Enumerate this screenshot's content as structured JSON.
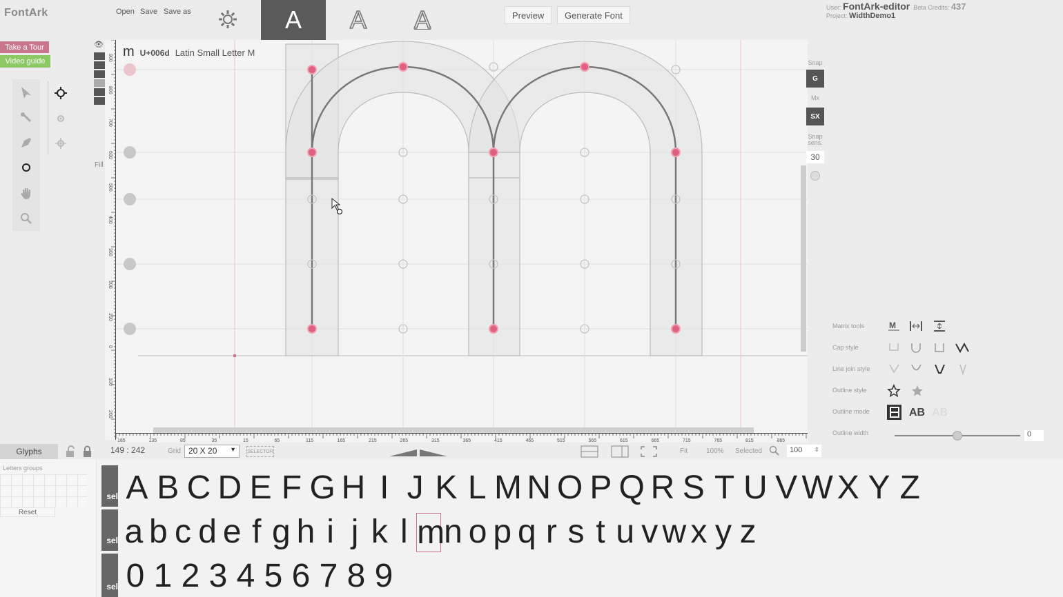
{
  "app": {
    "logo": "FontArk"
  },
  "menu": {
    "open": "Open",
    "save": "Save",
    "save_as": "Save as"
  },
  "toolbar": {
    "style_buttons": [
      {
        "label": "A",
        "state": "active"
      },
      {
        "label": "A",
        "state": "outline"
      },
      {
        "label": "A",
        "state": "outline-underline"
      }
    ],
    "preview": "Preview",
    "generate": "Generate Font"
  },
  "user": {
    "user_label": "User:",
    "username": "FontArk-editor",
    "credits_label": "Beta Credits:",
    "credits": "437",
    "project_label": "Project:",
    "project": "WidthDemo1"
  },
  "left_panel": {
    "tour": "Take a Tour",
    "video": "Video guide",
    "tools": [
      "select-arrow-icon",
      "node-select-icon",
      "pen-icon",
      "circle-icon",
      "hand-icon",
      "zoom-icon"
    ],
    "node_tools": [
      "crosshair-icon",
      "dot-icon",
      "target-icon"
    ],
    "fill_label": "Fill"
  },
  "glyph_header": {
    "char": "m",
    "code": "U+006d",
    "name": "Latin Small Letter M"
  },
  "status": {
    "coords": "149 : 242",
    "grid_label": "Grid",
    "grid_value": "20 X 20",
    "selector": "SELECTOR",
    "fit": "Fit",
    "zoom_pct": "100%",
    "selected_label": "Selected",
    "selected_value": "100"
  },
  "snap": {
    "label": "Snap",
    "g": "G",
    "mx_label": "Mx",
    "sx": "SX",
    "sens_label_1": "Snap",
    "sens_label_2": "sens.",
    "sens_value": "30"
  },
  "properties": {
    "matrix_tools": "Matrix tools",
    "cap_style": "Cap style",
    "line_join": "Line join style",
    "outline_style": "Outline style",
    "outline_mode": "Outline mode",
    "outline_width": "Outline width",
    "outline_width_value": "0",
    "outline_mode_ab1": "AB",
    "outline_mode_ab2": "AB"
  },
  "glyph_panel": {
    "tab": "Glyphs",
    "groups_label": "Letters groups",
    "reset": "Reset",
    "select_label": "sel",
    "uppercase": [
      "A",
      "B",
      "C",
      "D",
      "E",
      "F",
      "G",
      "H",
      "I",
      "J",
      "K",
      "L",
      "M",
      "N",
      "O",
      "P",
      "Q",
      "R",
      "S",
      "T",
      "U",
      "V",
      "W",
      "X",
      "Y",
      "Z"
    ],
    "lowercase": [
      "a",
      "b",
      "c",
      "d",
      "e",
      "f",
      "g",
      "h",
      "i",
      "j",
      "k",
      "l",
      "m",
      "n",
      "o",
      "p",
      "q",
      "r",
      "s",
      "t",
      "u",
      "v",
      "w",
      "x",
      "y",
      "z"
    ],
    "digits": [
      "0",
      "1",
      "2",
      "3",
      "4",
      "5",
      "6",
      "7",
      "8",
      "9"
    ],
    "selected_glyph": "m"
  },
  "ruler": {
    "h_labels": [
      "185",
      "135",
      "85",
      "35",
      "15",
      "65",
      "115",
      "165",
      "215",
      "265",
      "315",
      "365",
      "415",
      "465",
      "515",
      "565",
      "615",
      "665",
      "715",
      "765",
      "815",
      "865"
    ],
    "v_labels": [
      "900",
      "800",
      "700",
      "600",
      "500",
      "400",
      "300",
      "200",
      "100",
      "0",
      "100",
      "200"
    ]
  },
  "colors": {
    "accent": "#c8768c",
    "node": "#e0607f",
    "green": "#8cc864",
    "dark": "#5a5a5a"
  }
}
